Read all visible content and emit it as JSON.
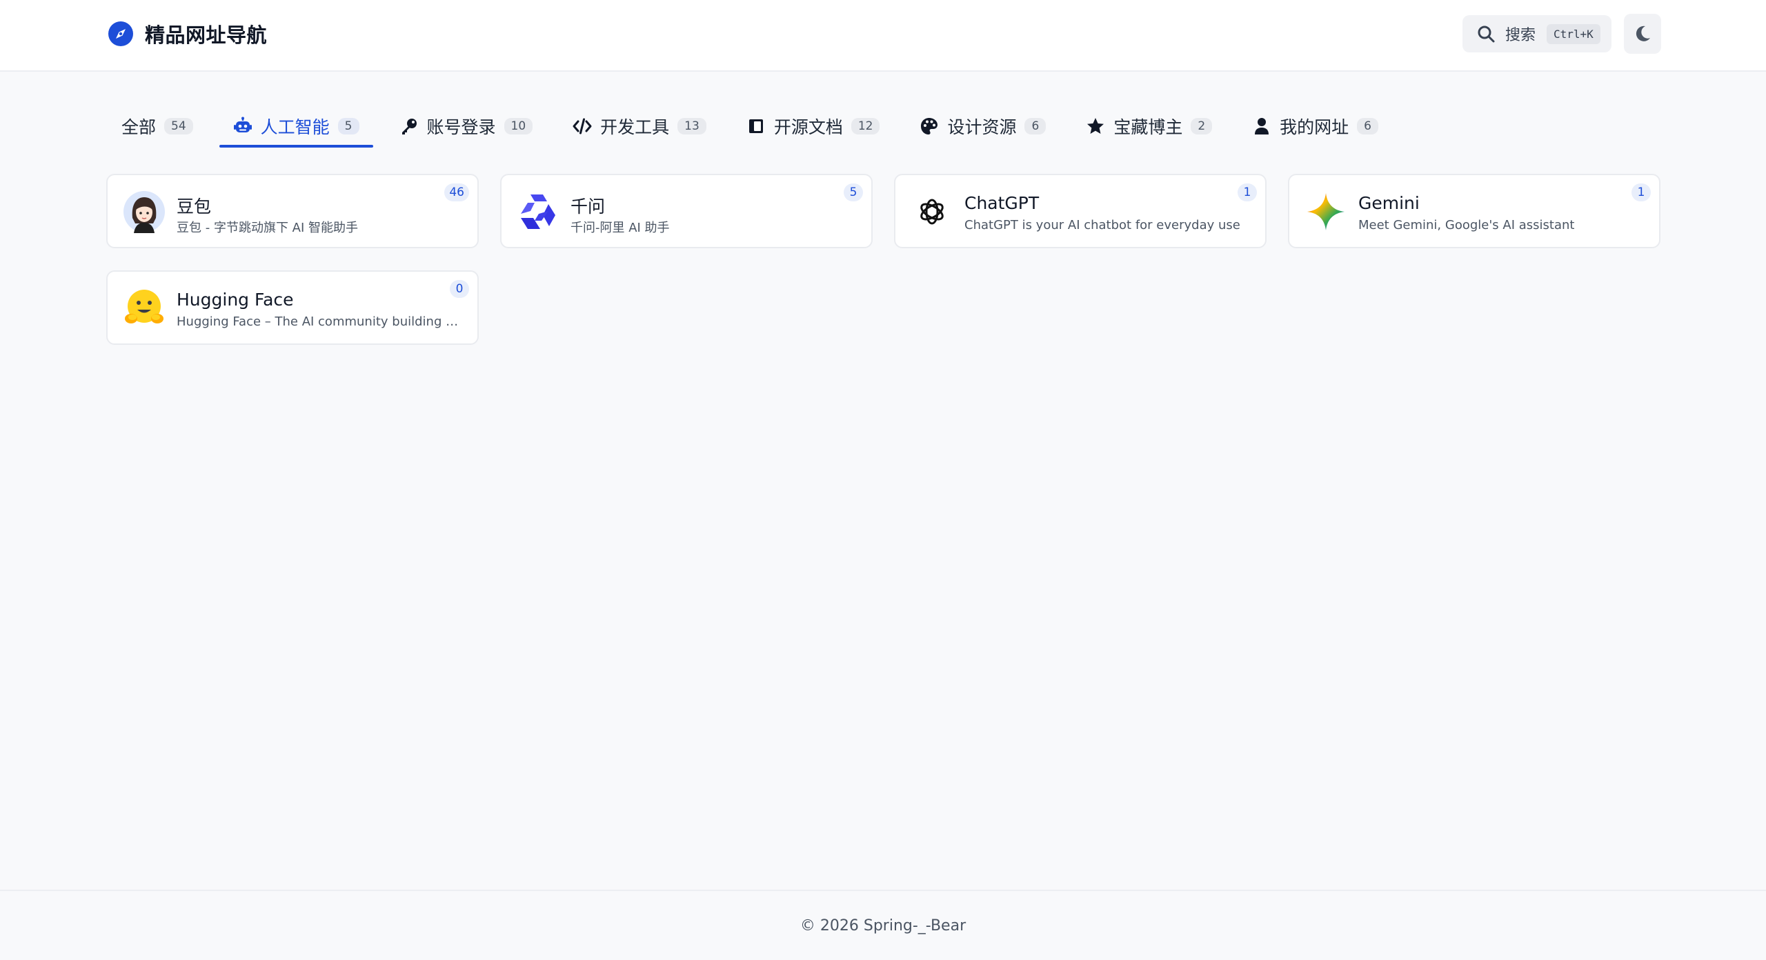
{
  "header": {
    "title": "精品网址导航",
    "logo_icon": "compass-icon",
    "search_label": "搜索",
    "search_shortcut": "Ctrl+K",
    "theme_icon": "moon-icon"
  },
  "tabs": [
    {
      "label": "全部",
      "count": "54",
      "icon": "",
      "active": false
    },
    {
      "label": "人工智能",
      "count": "5",
      "icon": "robot-icon",
      "active": true
    },
    {
      "label": "账号登录",
      "count": "10",
      "icon": "key-icon",
      "active": false
    },
    {
      "label": "开发工具",
      "count": "13",
      "icon": "code-icon",
      "active": false
    },
    {
      "label": "开源文档",
      "count": "12",
      "icon": "book-icon",
      "active": false
    },
    {
      "label": "设计资源",
      "count": "6",
      "icon": "palette-icon",
      "active": false
    },
    {
      "label": "宝藏博主",
      "count": "2",
      "icon": "star-icon",
      "active": false
    },
    {
      "label": "我的网址",
      "count": "6",
      "icon": "user-icon",
      "active": false
    }
  ],
  "cards": [
    {
      "name": "豆包",
      "desc": "豆包 - 字节跳动旗下 AI 智能助手",
      "count": "46",
      "icon": "doubao-avatar-icon"
    },
    {
      "name": "千问",
      "desc": "千问-阿里 AI 助手",
      "count": "5",
      "icon": "qwen-logo-icon"
    },
    {
      "name": "ChatGPT",
      "desc": "ChatGPT is your AI chatbot for everyday use",
      "count": "1",
      "icon": "openai-logo-icon"
    },
    {
      "name": "Gemini",
      "desc": "Meet Gemini, Google's AI assistant",
      "count": "1",
      "icon": "gemini-sparkle-icon"
    },
    {
      "name": "Hugging Face",
      "desc": "Hugging Face – The AI community building the future.",
      "count": "0",
      "icon": "hugging-face-emoji-icon"
    }
  ],
  "footer": {
    "copyright": "© 2026 Spring-_-Bear"
  },
  "colors": {
    "accent": "#1d4ed8",
    "background": "#f8f9fb",
    "card_border": "#e9ebef"
  }
}
